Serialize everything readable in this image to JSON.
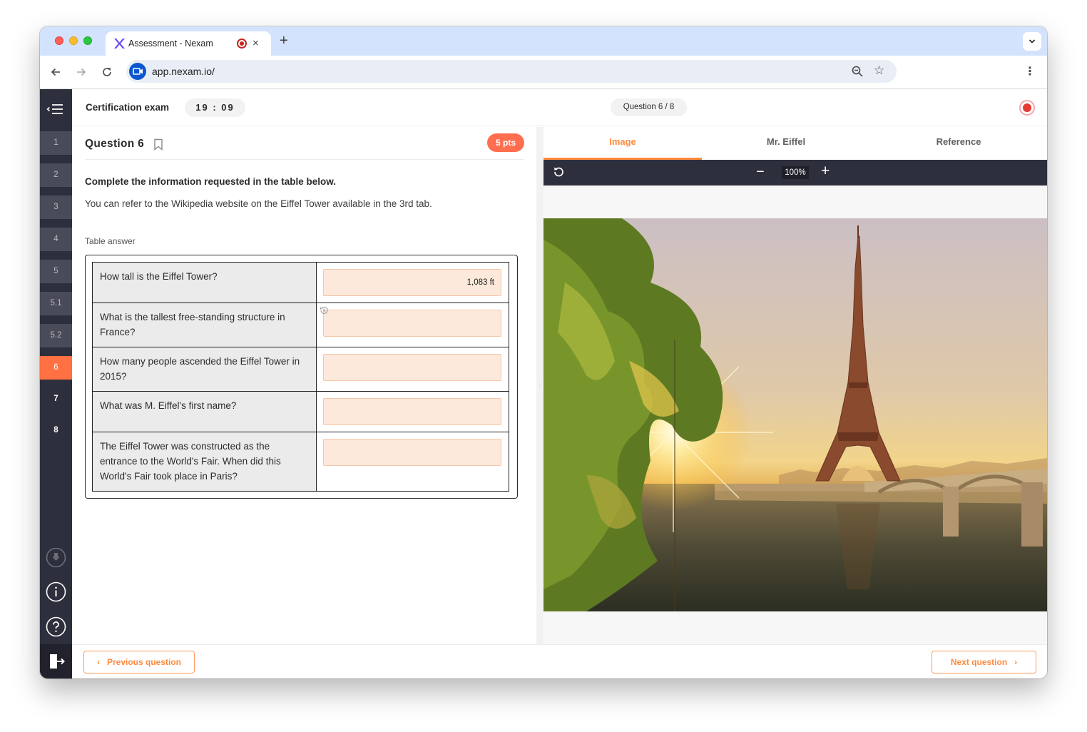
{
  "browser": {
    "tab_title": "Assessment - Nexam",
    "url": "app.nexam.io/",
    "new_tab": "+",
    "close_tab": "×"
  },
  "exam": {
    "title": "Certification exam",
    "timer": "19 : 09",
    "question_counter": "Question 6 / 8"
  },
  "sidebar": {
    "items": [
      {
        "label": "1",
        "state": "done"
      },
      {
        "label": "2",
        "state": "done"
      },
      {
        "label": "3",
        "state": "done"
      },
      {
        "label": "4",
        "state": "done"
      },
      {
        "label": "5",
        "state": "done"
      },
      {
        "label": "5.1",
        "state": "done"
      },
      {
        "label": "5.2",
        "state": "done"
      },
      {
        "label": "6",
        "state": "active"
      },
      {
        "label": "7",
        "state": "todo"
      },
      {
        "label": "8",
        "state": "todo"
      }
    ]
  },
  "question": {
    "title": "Question 6",
    "points": "5 pts",
    "instruction_bold": "Complete the information requested in the table below.",
    "instruction_text": "You can refer to the Wikipedia website on the Eiffel Tower available in the 3rd tab.",
    "table_label": "Table answer",
    "rows": [
      {
        "question": "How tall is the Eiffel Tower?",
        "answer": "1,083 ft"
      },
      {
        "question": "What is the tallest free-standing structure in France?",
        "answer": ""
      },
      {
        "question": "How many people ascended the Eiffel Tower in 2015?",
        "answer": ""
      },
      {
        "question": "What was M. Eiffel's first name?",
        "answer": ""
      },
      {
        "question": "The Eiffel Tower was constructed as the entrance to the World's Fair. When did this World's Fair took place in Paris?",
        "answer": ""
      }
    ]
  },
  "resources": {
    "tabs": [
      "Image",
      "Mr. Eiffel",
      "Reference"
    ],
    "active_tab": "Image",
    "zoom": "100%"
  },
  "footer": {
    "prev_label": "Previous question",
    "next_label": "Next question"
  },
  "colors": {
    "accent": "#ff8a3d",
    "sidebar_bg": "#2e2f3d",
    "active_item": "#ff7043",
    "input_bg": "#fde9db"
  }
}
